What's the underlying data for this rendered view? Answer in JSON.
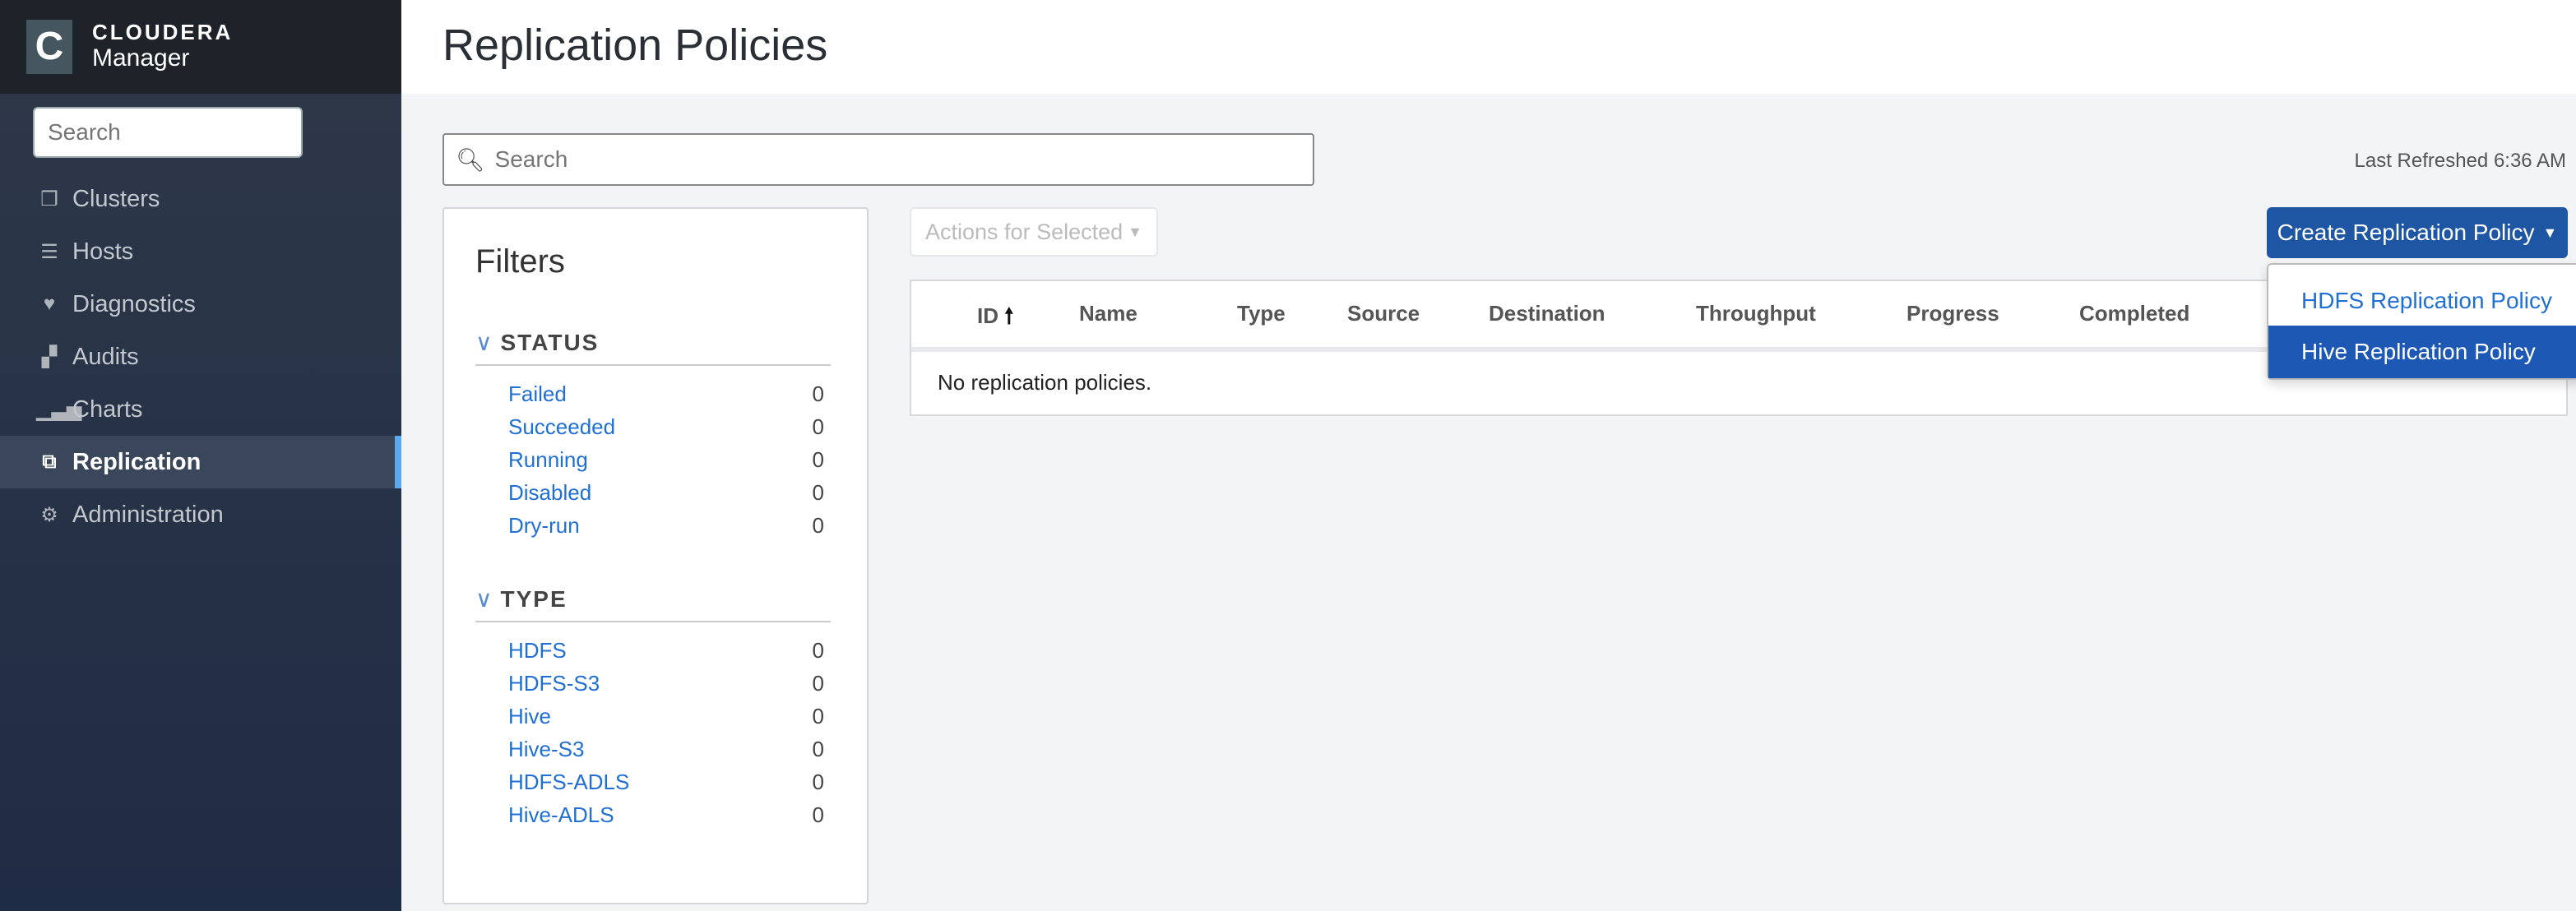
{
  "brand": {
    "name": "CLOUDERA",
    "sub": "Manager",
    "logo": "C"
  },
  "sidebar": {
    "search_placeholder": "Search",
    "items": [
      {
        "label": "Clusters",
        "icon": "cubes-icon"
      },
      {
        "label": "Hosts",
        "icon": "server-icon"
      },
      {
        "label": "Diagnostics",
        "icon": "heartbeat-icon"
      },
      {
        "label": "Audits",
        "icon": "binoculars-icon"
      },
      {
        "label": "Charts",
        "icon": "bar-chart-icon"
      },
      {
        "label": "Replication",
        "icon": "copy-icon",
        "active": true
      },
      {
        "label": "Administration",
        "icon": "gear-icon"
      }
    ]
  },
  "page": {
    "title": "Replication Policies",
    "search_placeholder": "Search",
    "last_refreshed": "Last Refreshed 6:36 AM"
  },
  "filters": {
    "title": "Filters",
    "status": {
      "heading": "STATUS",
      "items": [
        {
          "label": "Failed",
          "count": "0"
        },
        {
          "label": "Succeeded",
          "count": "0"
        },
        {
          "label": "Running",
          "count": "0"
        },
        {
          "label": "Disabled",
          "count": "0"
        },
        {
          "label": "Dry-run",
          "count": "0"
        }
      ]
    },
    "type": {
      "heading": "TYPE",
      "items": [
        {
          "label": "HDFS",
          "count": "0"
        },
        {
          "label": "HDFS-S3",
          "count": "0"
        },
        {
          "label": "Hive",
          "count": "0"
        },
        {
          "label": "Hive-S3",
          "count": "0"
        },
        {
          "label": "HDFS-ADLS",
          "count": "0"
        },
        {
          "label": "Hive-ADLS",
          "count": "0"
        }
      ]
    }
  },
  "toolbar": {
    "actions_label": "Actions for Selected",
    "create_label": "Create Replication Policy"
  },
  "table": {
    "columns": [
      "ID",
      "Name",
      "Type",
      "Source",
      "Destination",
      "Throughput",
      "Progress",
      "Completed"
    ],
    "empty": "No replication policies."
  },
  "dropdown": {
    "items": [
      "HDFS Replication Policy",
      "Hive Replication Policy"
    ]
  },
  "colors": {
    "primary": "#1f56a3",
    "link": "#1f6fd4",
    "sidebar": "#1f2c45"
  }
}
